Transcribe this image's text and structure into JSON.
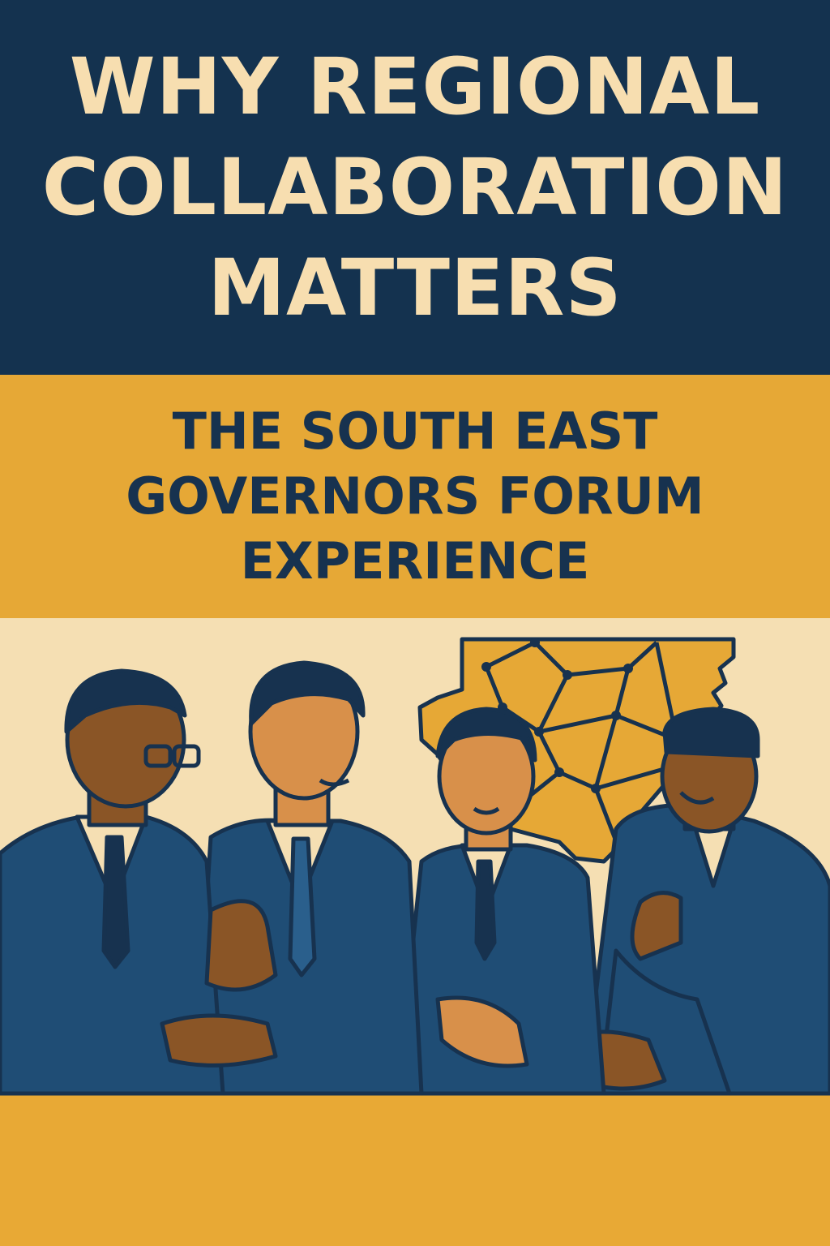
{
  "title": {
    "lines": [
      "WHY REGIONAL",
      "COLLABORATION",
      "MATTERS"
    ]
  },
  "subtitle": {
    "lines": [
      "THE SOUTH EAST",
      "GOVERNORS FORUM",
      "EXPERIENCE"
    ]
  },
  "colors": {
    "navy": "#14324f",
    "cream": "#f7deb0",
    "gold": "#e6a836",
    "suit": "#1f4d75",
    "skin_dark": "#8a5526",
    "skin_light": "#d8904a"
  },
  "illustration": {
    "subject": "four men in suits in discussion at a table with a regional map behind them"
  }
}
